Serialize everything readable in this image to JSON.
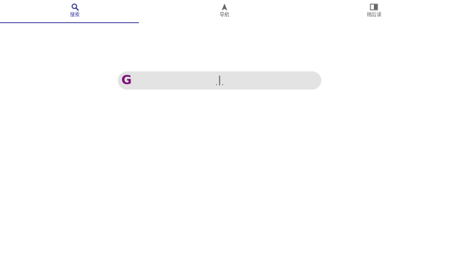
{
  "tabs": [
    {
      "label": "搜索",
      "icon": "search-icon",
      "active": true
    },
    {
      "label": "导航",
      "icon": "navigation-arrow-icon",
      "active": false
    },
    {
      "label": "稍后读",
      "icon": "read-later-icon",
      "active": false
    }
  ],
  "search": {
    "logo_text": "G",
    "value": "",
    "placeholder": ""
  },
  "colors": {
    "active_tab": "#3a3aa8",
    "underline": "#1a1a8a",
    "logo": "#7a0f7a",
    "searchbar_bg": "#e3e3e3",
    "tab_label": "#666666"
  }
}
